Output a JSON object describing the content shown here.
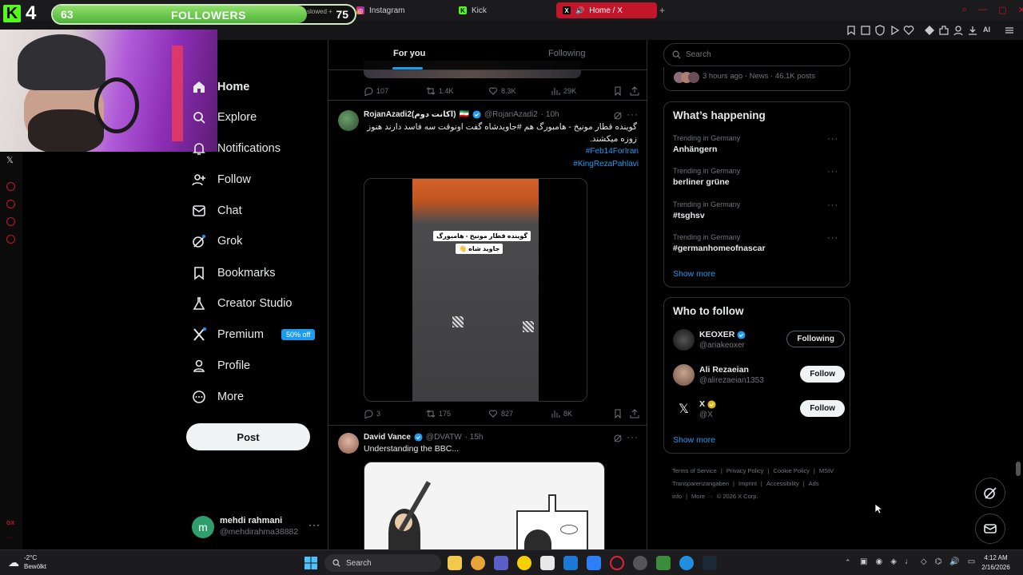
{
  "stream": {
    "kick_count": "4",
    "followers_current": "63",
    "followers_label": "FOLLOWERS",
    "followers_goal": "75",
    "followers_progress": 0.84,
    "bg_text": "slowed +"
  },
  "browser": {
    "tabs": [
      {
        "label": "Instagram",
        "active": false
      },
      {
        "label": "Kick",
        "active": false
      },
      {
        "label": "Home / X",
        "active": true
      }
    ],
    "ai_label": "AI",
    "accent": "#c4162a"
  },
  "nav": {
    "items": [
      {
        "label": "Home",
        "icon": "home-icon"
      },
      {
        "label": "Explore",
        "icon": "search-icon"
      },
      {
        "label": "Notifications",
        "icon": "bell-icon"
      },
      {
        "label": "Follow",
        "icon": "person-add-icon"
      },
      {
        "label": "Chat",
        "icon": "mail-icon"
      },
      {
        "label": "Grok",
        "icon": "grok-icon"
      },
      {
        "label": "Bookmarks",
        "icon": "bookmark-icon"
      },
      {
        "label": "Creator Studio",
        "icon": "flask-icon"
      },
      {
        "label": "Premium",
        "icon": "x-icon"
      },
      {
        "label": "Profile",
        "icon": "person-icon"
      },
      {
        "label": "More",
        "icon": "more-circle-icon"
      }
    ],
    "premium_badge": "50% off",
    "post_label": "Post"
  },
  "account": {
    "initial": "m",
    "name": "mehdi rahmani",
    "handle": "@mehdirahma38882",
    "more": "···"
  },
  "timeline": {
    "tabs": [
      "For you",
      "Following"
    ],
    "top_actions": {
      "replies": "107",
      "reposts": "1.4K",
      "likes": "8.3K",
      "views": "29K"
    },
    "tweet1": {
      "name": "RojanAzadi2(اکانت دوم)",
      "flag": "🇮🇷",
      "handle": "@RojanAzadi2",
      "time": "· 10h",
      "text": "گوینده قطار مونیخ - هامبورگ هم #جاویدشاه گفت اونوقت سه فاسد دارند هنوز زوزه میکشند.",
      "hashtag1": "#Feb14ForIran",
      "hashtag2": "#KingRezaPahlavi",
      "video_caption1": "گوینده قطار مونیخ - هامبورگ",
      "video_caption2": "جاوید شاه 👋",
      "actions": {
        "replies": "3",
        "reposts": "175",
        "likes": "827",
        "views": "8K"
      }
    },
    "tweet2": {
      "name": "David Vance",
      "handle": "@DVATW",
      "time": "· 15h",
      "text": "Understanding the BBC..."
    }
  },
  "sidebar": {
    "search_placeholder": "Search",
    "top_meta": "3 hours ago · News · 46.1K posts",
    "happening_title": "What’s happening",
    "trends": [
      {
        "context": "Trending in Germany",
        "title": "Anhängern"
      },
      {
        "context": "Trending in Germany",
        "title": "berliner grüne"
      },
      {
        "context": "Trending in Germany",
        "title": "#tsghsv"
      },
      {
        "context": "Trending in Germany",
        "title": "#germanhomeofnascar"
      }
    ],
    "show_more": "Show more",
    "wtf_title": "Who to follow",
    "wtf": [
      {
        "name": "KEOXER",
        "handle": "@ariakeoxer",
        "button": "Following"
      },
      {
        "name": "Ali Rezaeian",
        "handle": "@alirezaeian1353",
        "button": "Follow"
      },
      {
        "name": "X",
        "handle": "@X",
        "button": "Follow"
      }
    ],
    "wtf_show_more": "Show more",
    "footer": [
      "Terms of Service",
      "|",
      "Privacy Policy",
      "|",
      "Cookie Policy",
      "|",
      "MStV Transparenzangaben",
      "|",
      "Imprint",
      "|",
      "Accessibility",
      "|",
      "Ads info",
      "|",
      "More ···",
      "© 2026 X Corp."
    ]
  },
  "taskbar": {
    "temp": "-2°C",
    "weather": "Bewölkt",
    "search": "Search",
    "time": "4:12 AM",
    "date": "2/16/2026"
  }
}
